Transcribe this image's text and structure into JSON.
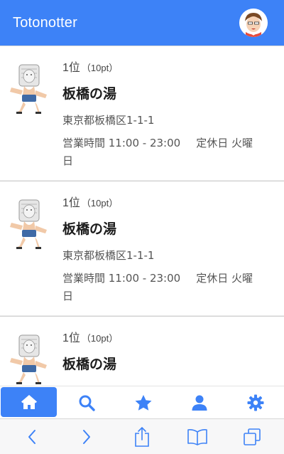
{
  "header": {
    "title": "Totonotter",
    "avatar_icon": "user-avatar-icon"
  },
  "ranking": [
    {
      "rank": "1位",
      "points": "（10pt）",
      "name": "板橋の湯",
      "address": "東京都板橋区1-1-1",
      "hours": "営業時間 11:00 - 23:00",
      "closed": "定休日 火曜日"
    },
    {
      "rank": "1位",
      "points": "（10pt）",
      "name": "板橋の湯",
      "address": "東京都板橋区1-1-1",
      "hours": "営業時間 11:00 - 23:00",
      "closed": "定休日 火曜日"
    },
    {
      "rank": "1位",
      "points": "（10pt）",
      "name": "板橋の湯",
      "address": "",
      "hours": "",
      "closed": ""
    }
  ],
  "tabbar": {
    "items": [
      {
        "icon": "home-icon",
        "active": true
      },
      {
        "icon": "search-icon",
        "active": false
      },
      {
        "icon": "star-icon",
        "active": false
      },
      {
        "icon": "user-icon",
        "active": false
      },
      {
        "icon": "gear-icon",
        "active": false
      }
    ],
    "accent": "#3d82f7"
  },
  "browser_toolbar": {
    "items": [
      "back-icon",
      "forward-icon",
      "share-icon",
      "bookmarks-icon",
      "tabs-icon"
    ],
    "color": "#3d82f7"
  }
}
